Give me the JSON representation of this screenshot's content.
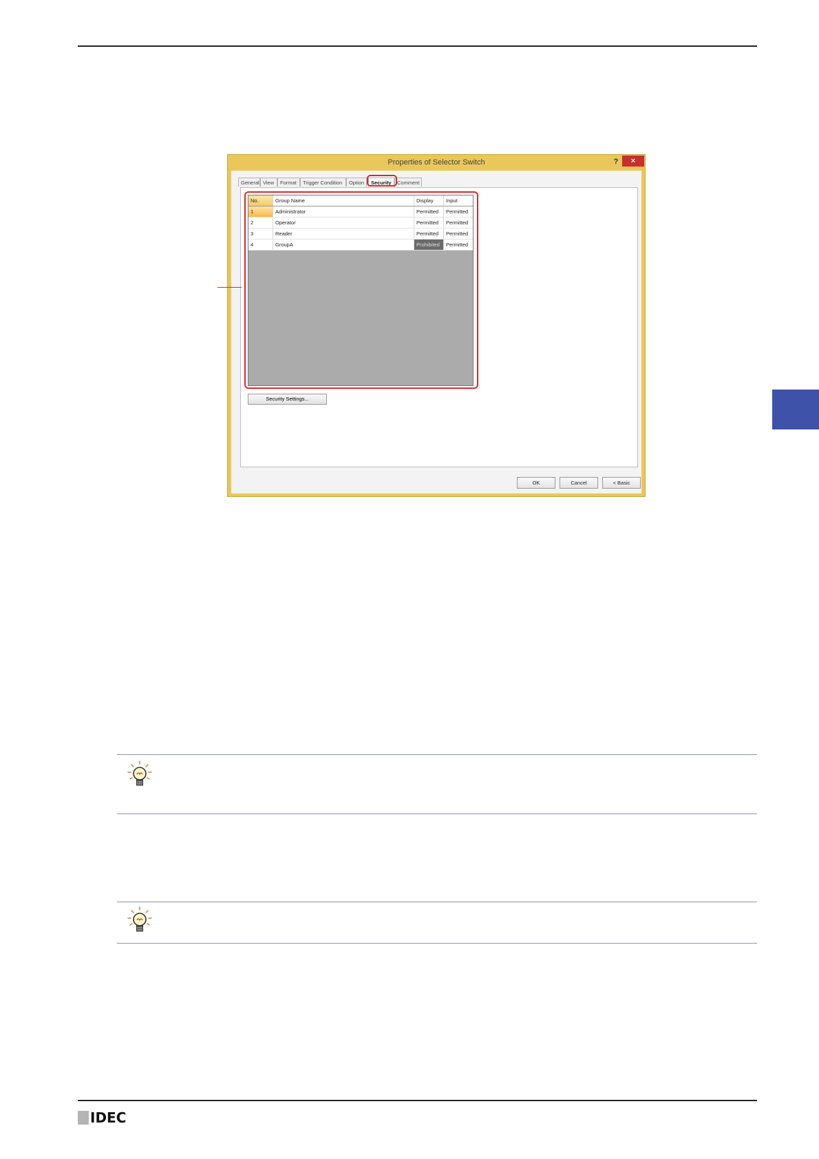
{
  "dialog": {
    "title": "Properties of Selector Switch",
    "help": "?",
    "close": "×",
    "tabs": [
      "General",
      "View",
      "Format",
      "Trigger Condition",
      "Option",
      "Security",
      "Comment"
    ],
    "active_tab": "Security",
    "table": {
      "headers": [
        "No.",
        "Group Name",
        "Display",
        "Input"
      ],
      "rows": [
        {
          "no": "1",
          "name": "Administrator",
          "display": "Permitted",
          "input": "Permitted"
        },
        {
          "no": "2",
          "name": "Operator",
          "display": "Permitted",
          "input": "Permitted"
        },
        {
          "no": "3",
          "name": "Reader",
          "display": "Permitted",
          "input": "Permitted"
        },
        {
          "no": "4",
          "name": "GroupA",
          "display": "Prohibited",
          "input": "Permitted"
        }
      ]
    },
    "security_settings_button": "Security Settings...",
    "ok_button": "OK",
    "cancel_button": "Cancel",
    "basic_button": "< Basic"
  },
  "footer": {
    "logo": "IDEC"
  },
  "colors": {
    "accent": "#3d52a8",
    "highlight": "#d42a2a",
    "dialog_frame": "#e9c75a"
  }
}
